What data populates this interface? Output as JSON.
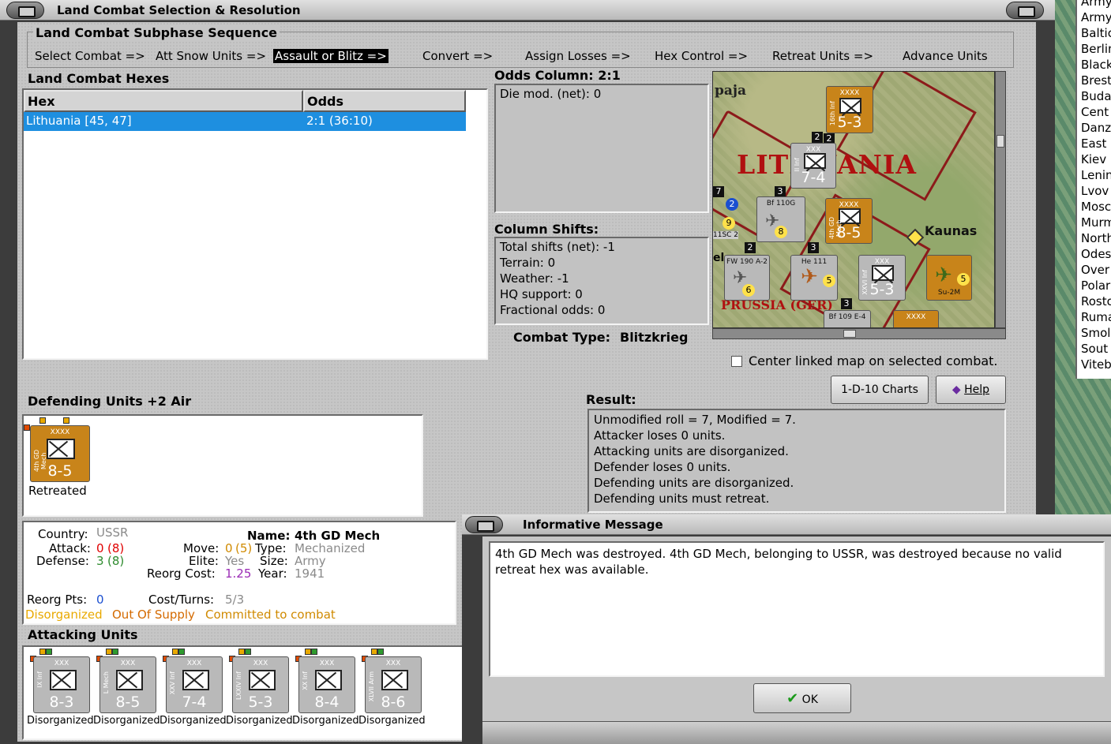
{
  "main_window": {
    "title": "Land Combat Selection & Resolution",
    "subphase_title": "Land Combat Subphase Sequence",
    "steps": [
      "Select Combat =>",
      "Att Snow Units =>",
      "Assault or Blitz =>",
      "Convert =>",
      "Assign Losses =>",
      "Hex Control =>",
      "Retreat Units =>",
      "Advance Units"
    ],
    "hexes_title": "Land Combat Hexes",
    "hex_columns": [
      "Hex",
      "Odds"
    ],
    "hex_rows": [
      {
        "hex": "Lithuania [45, 47]",
        "odds": "2:1 (36:10)"
      }
    ],
    "odds_column": "Odds Column: 2:1",
    "die_mod": "Die mod. (net): 0",
    "column_shifts_title": "Column Shifts:",
    "shifts": [
      "Total shifts (net): -1",
      "Terrain: 0",
      "Weather: -1",
      "HQ support: 0",
      "Fractional odds: 0"
    ],
    "combat_type_label": "Combat Type:",
    "combat_type_value": "Blitzkrieg",
    "center_map_label": "Center linked map on selected combat.",
    "charts_button": "1-D-10 Charts",
    "help_button": "Help",
    "result_title": "Result:",
    "result_lines": [
      "Unmodified roll = 7, Modified = 7.",
      "Attacker loses 0 units.",
      "Attacking units are disorganized.",
      "Defender loses 0 units.",
      "Defending units are disorganized.",
      "Defending units must retreat."
    ],
    "defending_title": "Defending Units +2 Air",
    "defender": {
      "size": "XXXX",
      "name": "4th GD Mech",
      "stats": "8-5",
      "status": "Retreated"
    },
    "details": {
      "country_label": "Country:",
      "country": "USSR",
      "name_label": "Name:",
      "name": "4th GD Mech",
      "attack_label": "Attack:",
      "attack": "0",
      "attack_paren": "(8)",
      "defense_label": "Defense:",
      "defense": "3",
      "defense_paren": "(8)",
      "move_label": "Move:",
      "move": "0",
      "move_paren": "(5)",
      "type_label": "Type:",
      "type": "Mechanized",
      "elite_label": "Elite:",
      "elite": "Yes",
      "size_label": "Size:",
      "size": "Army",
      "reorg_cost_label": "Reorg Cost:",
      "reorg_cost": "1.25",
      "year_label": "Year:",
      "year": "1941",
      "reorg_pts_label": "Reorg Pts:",
      "reorg_pts": "0",
      "cost_turns_label": "Cost/Turns:",
      "cost_turns": "5/3",
      "flags": [
        "Disorganized",
        "Out Of Supply",
        "Committed to combat"
      ]
    },
    "attacking_title": "Attacking Units",
    "attackers": [
      {
        "size": "XXX",
        "name": "IX Inf",
        "stats": "8-3",
        "status": "Disorganized"
      },
      {
        "size": "XXX",
        "name": "L Mech",
        "stats": "8-5",
        "status": "Disorganized"
      },
      {
        "size": "XXX",
        "name": "XXV Inf",
        "stats": "7-4",
        "status": "Disorganized"
      },
      {
        "size": "XXX",
        "name": "LXXIV Inf",
        "stats": "5-3",
        "status": "Disorganized"
      },
      {
        "size": "XXX",
        "name": "XX Inf",
        "stats": "8-4",
        "status": "Disorganized"
      },
      {
        "size": "XXX",
        "name": "XLVII Arm",
        "stats": "8-6",
        "status": "Disorganized"
      }
    ]
  },
  "map": {
    "labels": [
      "paja",
      "LITHUANIA",
      "Kaunas",
      "PRUSSIA (GER)"
    ],
    "counters": [
      {
        "size": "XXXX",
        "name": "16th Inf",
        "stats": "5-3"
      },
      {
        "size": "XXX",
        "name": "II Inf",
        "stats": "7-4"
      },
      {
        "size": "XXXX",
        "name": "4th GD Mech",
        "stats": "8-5"
      },
      {
        "name": "Bf 110G",
        "value": "8"
      },
      {
        "name": "FW 190 A-2",
        "value": "6"
      },
      {
        "name": "He 111",
        "value": "5"
      },
      {
        "size": "XXX",
        "name": "XXVI Inf",
        "stats": "5-3"
      },
      {
        "name": "Su-2M",
        "value": "5"
      },
      {
        "name": "Bf 109 E-4"
      },
      {
        "size": "XXXX"
      }
    ],
    "stack_numbers": [
      "2",
      "3",
      "2",
      "3",
      "2",
      "3",
      "7"
    ],
    "badges": [
      "2",
      "9"
    ],
    "edge_labels": [
      "11SC 2",
      "el",
      "1"
    ]
  },
  "side_list": {
    "items": [
      "Army",
      "Army",
      "Baltic",
      "Berlin",
      "Black",
      "Brest",
      "Buda",
      "Cent",
      "Danz",
      "East",
      "Kiev",
      "Lenin",
      "Lvov",
      "Mosc",
      "Murm",
      "North",
      "Odes",
      "Over",
      "Polar",
      "Rosto",
      "Ruma",
      "Smol",
      "Sout",
      "Viteb"
    ]
  },
  "dialog": {
    "title": "Informative Message",
    "message": "4th GD Mech was destroyed.  4th GD Mech, belonging to USSR, was destroyed because no valid retreat hex was available.",
    "ok_label": "OK"
  },
  "colors": {
    "selection": "#1e8fe0",
    "orange_unit": "#c8841a",
    "gray_unit": "#b9b9b9",
    "red": "#e00000",
    "green": "#2e8b2e",
    "amber": "#d08a00",
    "purple": "#9a2bb5",
    "gray_text": "#8a8a8a"
  }
}
